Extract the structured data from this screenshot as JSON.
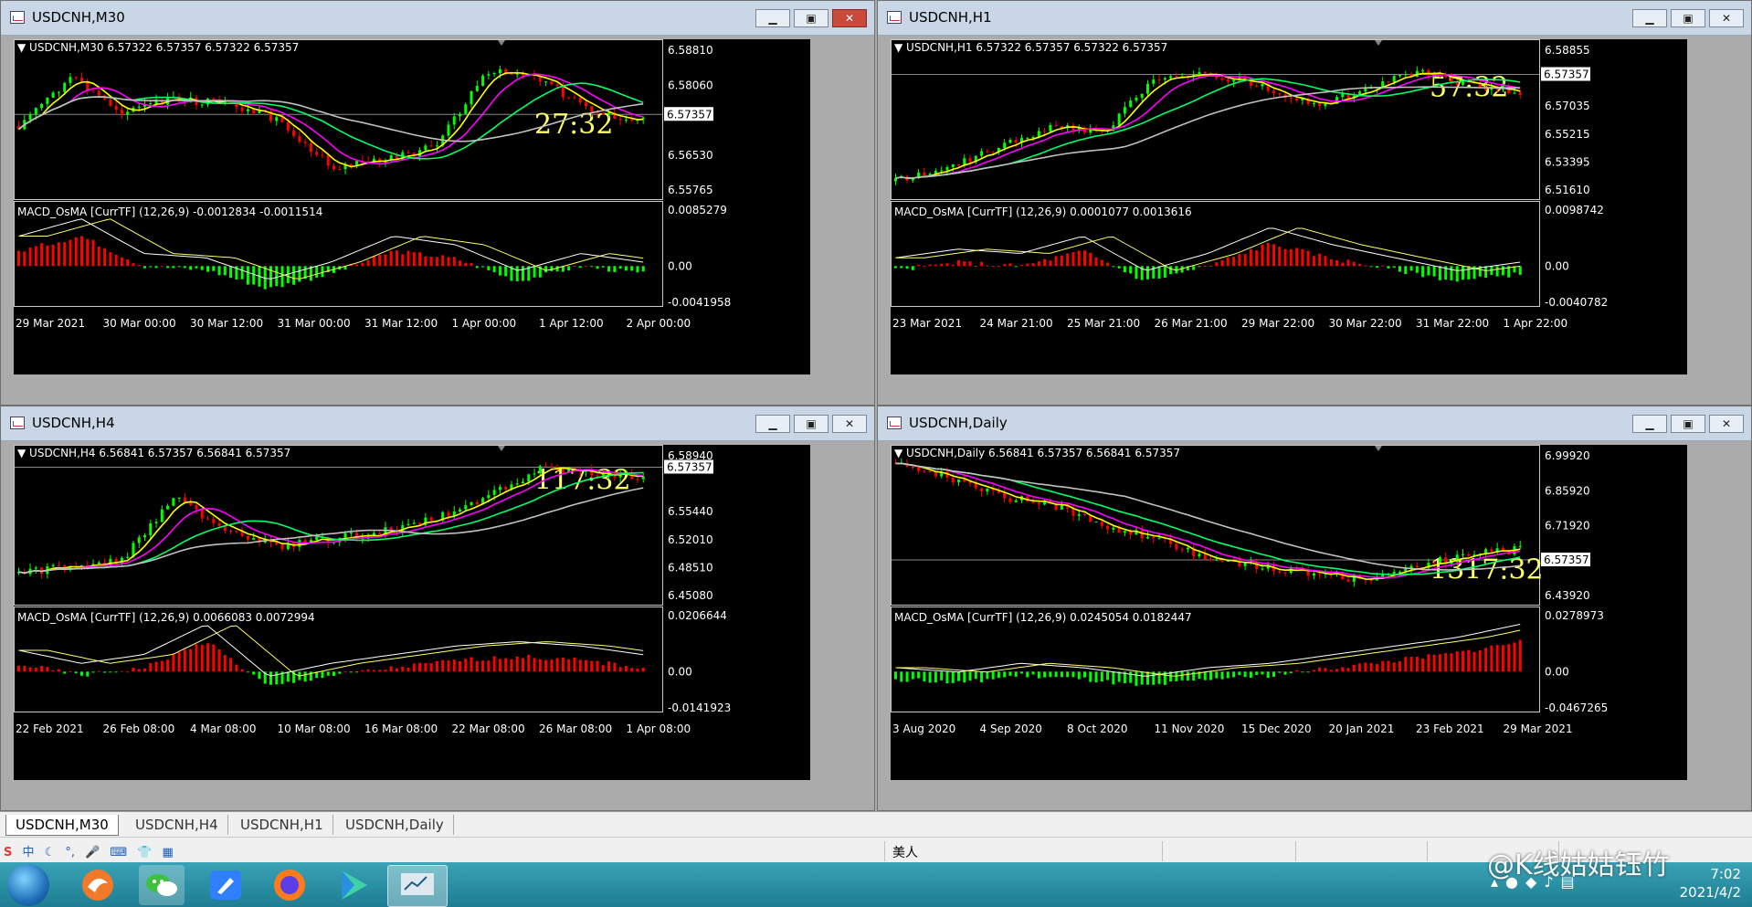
{
  "windows": [
    {
      "id": "m30",
      "title": "USDCNH,M30",
      "header": "USDCNH,M30  6.57322 6.57357 6.57322 6.57357",
      "timer": "27:32",
      "price_ticks": [
        "6.58810",
        "6.58060",
        "6.57357",
        "6.56530",
        "6.55765"
      ],
      "current_price": "6.57357",
      "macd_header": "MACD_OsMA [CurrTF] (12,26,9) -0.0012834 -0.0011514",
      "macd_ticks": [
        "0.0085279",
        "0.00",
        "-0.0041958"
      ],
      "time_labels": [
        "29 Mar 2021",
        "30 Mar 00:00",
        "30 Mar 12:00",
        "31 Mar 00:00",
        "31 Mar 12:00",
        "1 Apr 00:00",
        "1 Apr 12:00",
        "2 Apr 00:00"
      ]
    },
    {
      "id": "h1",
      "title": "USDCNH,H1",
      "header": "USDCNH,H1  6.57322 6.57357 6.57322 6.57357",
      "timer": "57:32",
      "price_ticks": [
        "6.58855",
        "6.57357",
        "6.57035",
        "6.55215",
        "6.53395",
        "6.51610"
      ],
      "current_price": "6.57357",
      "macd_header": "MACD_OsMA [CurrTF] (12,26,9) 0.0001077 0.0013616",
      "macd_ticks": [
        "0.0098742",
        "0.00",
        "-0.0040782"
      ],
      "time_labels": [
        "23 Mar 2021",
        "24 Mar 21:00",
        "25 Mar 21:00",
        "26 Mar 21:00",
        "29 Mar 22:00",
        "30 Mar 22:00",
        "31 Mar 22:00",
        "1 Apr 22:00"
      ]
    },
    {
      "id": "h4",
      "title": "USDCNH,H4",
      "header": "USDCNH,H4  6.56841 6.57357 6.56841 6.57357",
      "timer": "117:32",
      "price_ticks": [
        "6.58940",
        "6.57357",
        "6.55440",
        "6.52010",
        "6.48510",
        "6.45080"
      ],
      "current_price": "6.57357",
      "macd_header": "MACD_OsMA [CurrTF] (12,26,9) 0.0066083 0.0072994",
      "macd_ticks": [
        "0.0206644",
        "0.00",
        "-0.0141923"
      ],
      "time_labels": [
        "22 Feb 2021",
        "26 Feb 08:00",
        "4 Mar 08:00",
        "10 Mar 08:00",
        "16 Mar 08:00",
        "22 Mar 08:00",
        "26 Mar 08:00",
        "1 Apr 08:00"
      ]
    },
    {
      "id": "d1",
      "title": "USDCNH,Daily",
      "header": "USDCNH,Daily  6.56841 6.57357 6.56841 6.57357",
      "timer": "1317:32",
      "price_ticks": [
        "6.99920",
        "6.85920",
        "6.71920",
        "6.57357",
        "6.43920"
      ],
      "current_price": "6.57357",
      "macd_header": "MACD_OsMA [CurrTF] (12,26,9) 0.0245054 0.0182447",
      "macd_ticks": [
        "0.0278973",
        "0.00",
        "-0.0467265"
      ],
      "time_labels": [
        "3 Aug 2020",
        "4 Sep 2020",
        "8 Oct 2020",
        "11 Nov 2020",
        "15 Dec 2020",
        "20 Jan 2021",
        "23 Feb 2021",
        "29 Mar 2021"
      ]
    }
  ],
  "tabs": [
    "USDCNH,M30",
    "USDCNH,H4",
    "USDCNH,H1",
    "USDCNH,Daily"
  ],
  "active_tab": "USDCNH,M30",
  "status": {
    "ime_label": "中",
    "text": "美人"
  },
  "clock": {
    "time": "7:02",
    "date": "2021/4/2"
  },
  "watermark": "@K线姑姑钰竹",
  "colors": {
    "bull_candle": "#ff0000",
    "bear_candle": "#00ff00",
    "ma_fast": "#ffff00",
    "ma_mid": "#ff00ff",
    "ma_slow": "#00ff66",
    "ma_long": "#c0c0c0",
    "timer": "#ffff66"
  }
}
